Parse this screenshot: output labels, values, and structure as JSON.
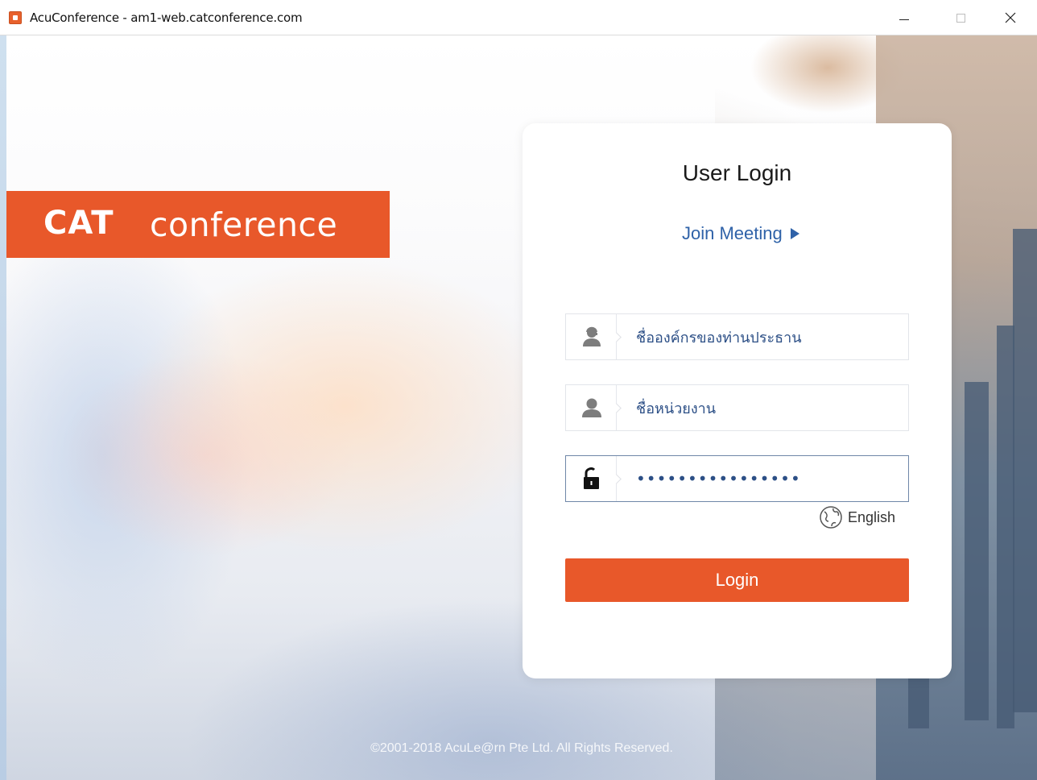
{
  "window": {
    "title": "AcuConference - am1-web.catconference.com",
    "minimize": "–",
    "maximize": "□",
    "close": "✕"
  },
  "brand": {
    "cat": "CAT",
    "conference": "conference",
    "color": "#e8582a"
  },
  "login": {
    "title": "User Login",
    "join_meeting": "Join Meeting",
    "fields": [
      {
        "icon": "organization-user-icon",
        "value": "ชื่อองค์กรของท่านประธาน"
      },
      {
        "icon": "user-icon",
        "value": "ชื่อหน่วยงาน"
      },
      {
        "icon": "lock-icon",
        "value": "••••••••••••••••"
      }
    ],
    "language": "English",
    "login_button": "Login",
    "accent_color": "#e8582a",
    "link_color": "#2f62a8"
  },
  "footer": {
    "copyright": "©2001-2018 AcuLe@rn Pte Ltd. All Rights Reserved."
  }
}
